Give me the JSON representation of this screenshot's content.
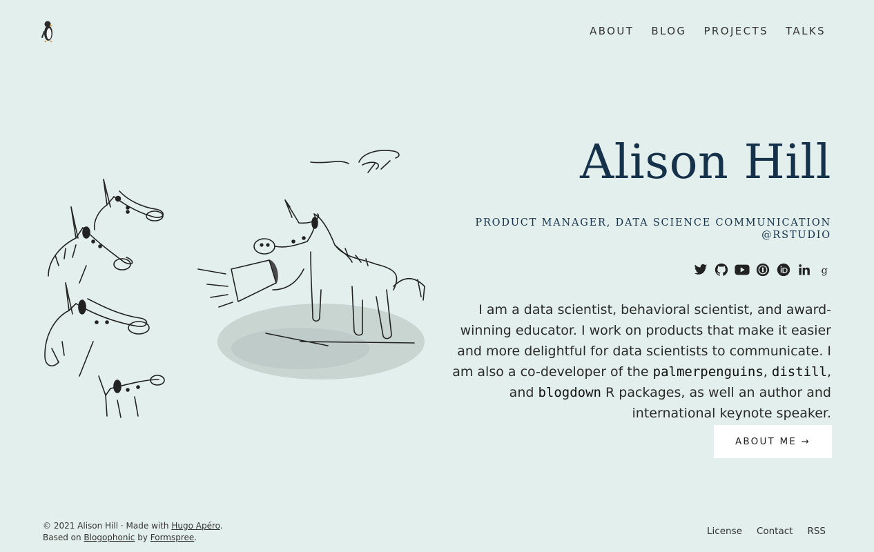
{
  "header": {
    "logo_icon": "penguin-icon",
    "nav": [
      {
        "label": "ABOUT"
      },
      {
        "label": "BLOG"
      },
      {
        "label": "PROJECTS"
      },
      {
        "label": "TALKS"
      }
    ]
  },
  "hero": {
    "illustration": "unicorns-megaphone-illustration",
    "title": "Alison Hill",
    "subtitle": "PRODUCT MANAGER, DATA SCIENCE COMMUNICATION @RSTUDIO",
    "social_icons": [
      "twitter-icon",
      "github-icon",
      "youtube-icon",
      "impactstory-icon",
      "orcid-icon",
      "linkedin-icon",
      "google-scholar-icon"
    ],
    "bio": {
      "part1": "I am a data scientist, behavioral scientist, and award-winning educator. I work on products that make it easier and more delightful for data scientists to communicate. I am also a co-developer of the ",
      "pkg1": "palmerpenguins",
      "sep1": ", ",
      "pkg2": "distill",
      "sep2": ", and ",
      "pkg3": "blogdown",
      "part2": " R packages, as well an author and international keynote speaker."
    },
    "cta": "ABOUT ME →"
  },
  "footer": {
    "copyright": "© 2021 Alison Hill",
    "dot": " · ",
    "made_with": "Made with ",
    "hugo_link": "Hugo Apéro",
    "period1": ".",
    "based_on": "Based on ",
    "blogophonic_link": "Blogophonic",
    "by": " by ",
    "formspree_link": "Formspree",
    "period2": ".",
    "links": [
      {
        "label": "License"
      },
      {
        "label": "Contact"
      },
      {
        "label": "RSS"
      }
    ]
  },
  "colors": {
    "background": "#e3efec",
    "title": "#16324a",
    "button_bg": "#ffffff"
  }
}
